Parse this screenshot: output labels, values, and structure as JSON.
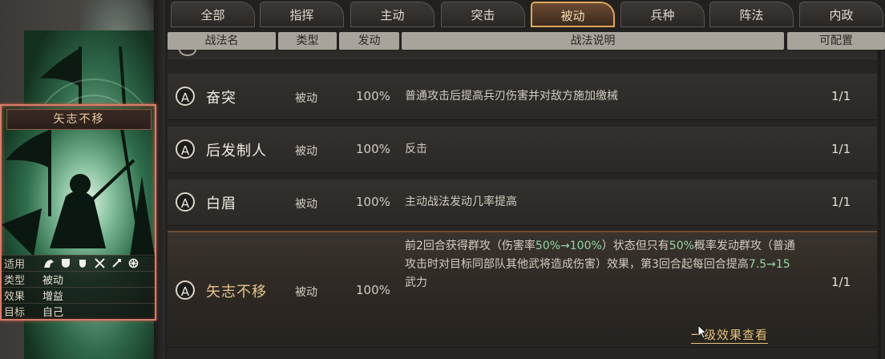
{
  "tabs": [
    {
      "label": "全部"
    },
    {
      "label": "指挥"
    },
    {
      "label": "主动"
    },
    {
      "label": "突击"
    },
    {
      "label": "被动"
    },
    {
      "label": "兵种"
    },
    {
      "label": "阵法"
    },
    {
      "label": "内政"
    }
  ],
  "active_tab": "被动",
  "columns": {
    "name": "战法名",
    "type": "类型",
    "rate": "发动",
    "desc": "战法说明",
    "config": "可配置"
  },
  "rows": [
    {
      "grade": "A",
      "name": "奋突",
      "type": "被动",
      "rate": "100%",
      "desc": "普通攻击后提高兵刃伤害并对敌方施加缴械",
      "config": "1/1"
    },
    {
      "grade": "A",
      "name": "后发制人",
      "type": "被动",
      "rate": "100%",
      "desc": "反击",
      "config": "1/1"
    },
    {
      "grade": "A",
      "name": "白眉",
      "type": "被动",
      "rate": "100%",
      "desc": "主动战法发动几率提高",
      "config": "1/1"
    },
    {
      "grade": "A",
      "name": "矢志不移",
      "type": "被动",
      "rate": "100%",
      "config": "1/1",
      "desc_parts": {
        "p1": "前2回合获得群攻（伤害率",
        "h1": "50%→100%",
        "p2": "）状态但只有",
        "h2": "50%",
        "p3": "概率发动群攻（普通攻击时对目标同部队其他武将造成伤害）效果，第3回合起每回合提高",
        "h3": "7.5→15",
        "p4": "武力"
      },
      "link": "一级效果查看"
    }
  ],
  "card": {
    "title": "矢志不移",
    "labels": {
      "apply": "适用",
      "type": "类型",
      "effect": "效果",
      "target": "目标"
    },
    "type": "被动",
    "effect": "增益",
    "target": "自己",
    "apply_icons": [
      "cavalry-icon",
      "shield-icon",
      "shield-small-icon",
      "crossed-swords-icon",
      "bow-icon",
      "wheel-icon"
    ]
  },
  "colors": {
    "accent": "#e0a55a",
    "highlight_green": "#8fd6a4",
    "card_border": "#d97c6a",
    "gold_text": "#e7c48a"
  }
}
